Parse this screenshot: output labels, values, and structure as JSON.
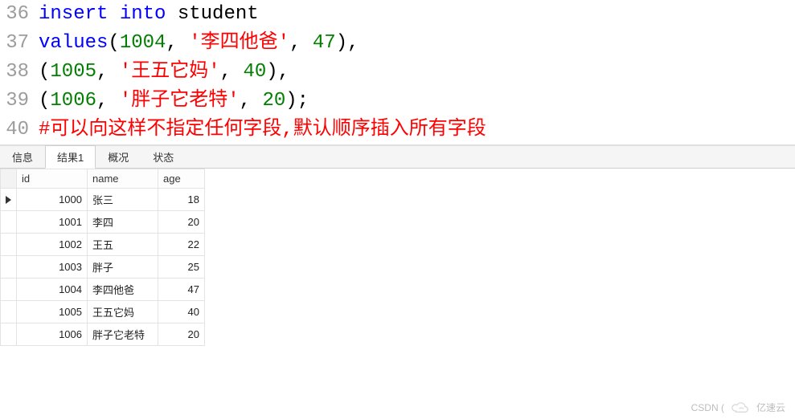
{
  "code": {
    "lines": [
      {
        "no": "36",
        "tokens": [
          {
            "t": "kw",
            "v": "insert"
          },
          {
            "t": "plain",
            "v": " "
          },
          {
            "t": "kw",
            "v": "into"
          },
          {
            "t": "plain",
            "v": " student"
          }
        ]
      },
      {
        "no": "37",
        "tokens": [
          {
            "t": "kw",
            "v": "values"
          },
          {
            "t": "plain",
            "v": "("
          },
          {
            "t": "num",
            "v": "1004"
          },
          {
            "t": "plain",
            "v": ", "
          },
          {
            "t": "str",
            "v": "'李四他爸'"
          },
          {
            "t": "plain",
            "v": ", "
          },
          {
            "t": "num",
            "v": "47"
          },
          {
            "t": "plain",
            "v": "),"
          }
        ]
      },
      {
        "no": "38",
        "tokens": [
          {
            "t": "plain",
            "v": "("
          },
          {
            "t": "num",
            "v": "1005"
          },
          {
            "t": "plain",
            "v": ", "
          },
          {
            "t": "str",
            "v": "'王五它妈'"
          },
          {
            "t": "plain",
            "v": ", "
          },
          {
            "t": "num",
            "v": "40"
          },
          {
            "t": "plain",
            "v": "),"
          }
        ]
      },
      {
        "no": "39",
        "tokens": [
          {
            "t": "plain",
            "v": "("
          },
          {
            "t": "num",
            "v": "1006"
          },
          {
            "t": "plain",
            "v": ", "
          },
          {
            "t": "str",
            "v": "'胖子它老特'"
          },
          {
            "t": "plain",
            "v": ", "
          },
          {
            "t": "num",
            "v": "20"
          },
          {
            "t": "plain",
            "v": ");"
          }
        ]
      },
      {
        "no": "40",
        "tokens": [
          {
            "t": "comment",
            "v": "#可以向这样不指定任何字段,默认顺序插入所有字段"
          }
        ]
      }
    ]
  },
  "tabs": {
    "items": [
      "信息",
      "结果1",
      "概况",
      "状态"
    ],
    "active_index": 1
  },
  "table": {
    "columns": [
      "id",
      "name",
      "age"
    ],
    "rows": [
      {
        "id": "1000",
        "name": "张三",
        "age": "18",
        "current": true
      },
      {
        "id": "1001",
        "name": "李四",
        "age": "20",
        "current": false
      },
      {
        "id": "1002",
        "name": "王五",
        "age": "22",
        "current": false
      },
      {
        "id": "1003",
        "name": "胖子",
        "age": "25",
        "current": false
      },
      {
        "id": "1004",
        "name": "李四他爸",
        "age": "47",
        "current": false
      },
      {
        "id": "1005",
        "name": "王五它妈",
        "age": "40",
        "current": false
      },
      {
        "id": "1006",
        "name": "胖子它老特",
        "age": "20",
        "current": false
      }
    ]
  },
  "watermark": {
    "text_left": "CSDN (",
    "brand": "亿速云"
  }
}
